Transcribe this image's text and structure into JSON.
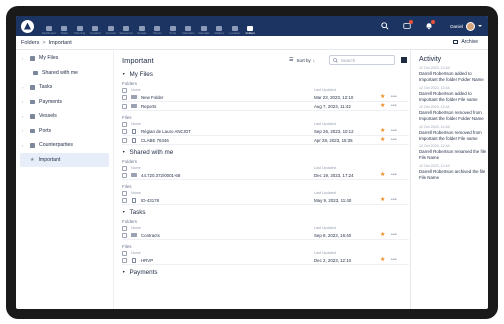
{
  "nav": {
    "items": [
      {
        "label": "Dashboard",
        "active": false
      },
      {
        "label": "Tasks",
        "active": false
      },
      {
        "label": "Planning",
        "active": false
      },
      {
        "label": "Contacts",
        "active": false
      },
      {
        "label": "Account",
        "active": false
      },
      {
        "label": "Resources",
        "active": false
      },
      {
        "label": "Vessels",
        "active": false
      },
      {
        "label": "Clients",
        "active": false
      },
      {
        "label": "Ports",
        "active": false
      },
      {
        "label": "Calculator",
        "active": false
      },
      {
        "label": "Calendar",
        "active": false
      },
      {
        "label": "Mailbox",
        "active": false
      },
      {
        "label": "Location",
        "active": false
      },
      {
        "label": "Folders",
        "active": true
      }
    ],
    "user_name": "Daniel"
  },
  "breadcrumb": {
    "root": "Folders",
    "sep": ">",
    "current": "Important"
  },
  "archive_label": "Archive",
  "sidebar": {
    "items": [
      {
        "label": "My Files",
        "child": false,
        "active": false
      },
      {
        "label": "Shared with me",
        "child": true,
        "active": false
      },
      {
        "label": "Tasks",
        "child": false,
        "active": false
      },
      {
        "label": "Payments",
        "child": false,
        "active": false
      },
      {
        "label": "Vessels",
        "child": false,
        "active": false
      },
      {
        "label": "Ports",
        "child": false,
        "active": false
      },
      {
        "label": "Counterparties",
        "child": false,
        "active": false
      },
      {
        "label": "Important",
        "child": true,
        "active": true
      }
    ]
  },
  "main": {
    "title": "Important",
    "sort_label": "Sort by",
    "sort_arrow": "↓",
    "search_placeholder": "Search",
    "col_name": "Name",
    "col_updated": "Last Updated",
    "sections": [
      {
        "title": "My Files",
        "groups": [
          {
            "label": "Folders",
            "rows": [
              {
                "name": "New Folder",
                "date": "Mar 23, 2023, 12:10",
                "kind": "folder"
              },
              {
                "name": "Reports",
                "date": "Aug 7, 2023, 11:42",
                "kind": "folder"
              }
            ]
          },
          {
            "label": "Files",
            "rows": [
              {
                "name": "Régian de Lauro ANCIOT",
                "date": "Sep 26, 2023, 10:12",
                "kind": "file"
              },
              {
                "name": "CLABE 76346",
                "date": "Apr 28, 2023, 15:35",
                "kind": "file"
              }
            ]
          }
        ]
      },
      {
        "title": "Shared with me",
        "groups": [
          {
            "label": "Folders",
            "rows": [
              {
                "name": "44.720.372/0001-68",
                "date": "Dec 19, 2023, 17:24",
                "kind": "folder"
              }
            ]
          },
          {
            "label": "Files",
            "rows": [
              {
                "name": "ID-43178",
                "date": "May 9, 2023, 11:40",
                "kind": "file"
              }
            ]
          }
        ]
      },
      {
        "title": "Tasks",
        "groups": [
          {
            "label": "Folders",
            "rows": [
              {
                "name": "Contracts",
                "date": "Sep 8, 2023, 16:40",
                "kind": "folder"
              }
            ]
          },
          {
            "label": "Files",
            "rows": [
              {
                "name": "HRVP",
                "date": "Dec 2, 2023, 12:10",
                "kind": "file"
              }
            ]
          }
        ]
      },
      {
        "title": "Payments",
        "groups": []
      }
    ]
  },
  "activity": {
    "title": "Activity",
    "entries": [
      {
        "time": "12 Oct 2023, 12:44",
        "text": "Darrell Robertson added to Important the folder Folder Name"
      },
      {
        "time": "12 Oct 2023, 12:44",
        "text": "Darrell Robertson added to Important the folder File name"
      },
      {
        "time": "12 Oct 2023, 12:44",
        "text": "Darrell Robertson removed from Important the folder Folder Name"
      },
      {
        "time": "12 Oct 2023, 12:44",
        "text": "Darrell Robertson removed from Important the folder File name"
      },
      {
        "time": "12 Oct 2023, 12:44",
        "text": "Darrell Robertson renamed the file File Name"
      },
      {
        "time": "12 Oct 2023, 12:44",
        "text": "Darrell Robertson archived the file File Name"
      }
    ]
  },
  "colors": {
    "topbar": "#1c3462",
    "star": "#f08a1c",
    "active_bg": "#e8eef9"
  }
}
